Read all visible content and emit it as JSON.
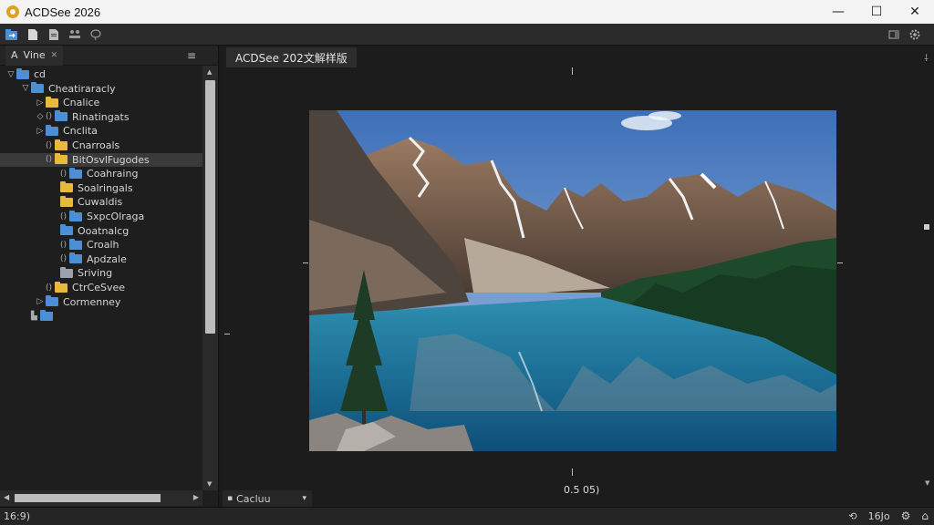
{
  "window": {
    "title": "ACDSee 2026",
    "minimize": "—",
    "maximize": "☐",
    "close": "✕"
  },
  "toolbar": {
    "icons": [
      "import-icon",
      "folder-icon",
      "file-icon",
      "people-icon",
      "tag-icon"
    ],
    "right_icons": [
      "panel-icon",
      "settings-icon"
    ]
  },
  "left_panel": {
    "tab_prefix": "A",
    "tab_label": "Vine",
    "tab_close": "✕",
    "menu_glyph": "≡",
    "tree": [
      {
        "arrow": "▽",
        "color": "blue",
        "label": "cd",
        "indent": 0
      },
      {
        "arrow": "▽",
        "color": "blue",
        "label": "Cheatiraracly",
        "indent": 1
      },
      {
        "arrow": "▷",
        "color": "yellow",
        "label": "Cnalice",
        "indent": 2
      },
      {
        "arrow": "◇",
        "color": "blue",
        "label": "Rinatingats",
        "indent": 2,
        "pre": "()"
      },
      {
        "arrow": "▷",
        "color": "blue",
        "label": "Cnclita",
        "indent": 2
      },
      {
        "arrow": "",
        "color": "yellow",
        "label": "Cnarroals",
        "indent": 2,
        "pre": "()"
      },
      {
        "arrow": "",
        "color": "yellow",
        "label": "BitOsvlFugodes",
        "indent": 2,
        "pre": "()",
        "selected": true
      },
      {
        "arrow": "",
        "color": "blue",
        "label": "Coahraing",
        "indent": 3,
        "pre": "()"
      },
      {
        "arrow": "",
        "color": "yellow",
        "label": "Soalringals",
        "indent": 3
      },
      {
        "arrow": "",
        "color": "yellow",
        "label": "Cuwaldis",
        "indent": 3
      },
      {
        "arrow": "",
        "color": "blue",
        "label": "SxpcOlraga",
        "indent": 3,
        "pre": "()"
      },
      {
        "arrow": "",
        "color": "blue",
        "label": "Ooatnalcg",
        "indent": 3
      },
      {
        "arrow": "",
        "color": "blue",
        "label": "Croalh",
        "indent": 3,
        "pre": "()"
      },
      {
        "arrow": "",
        "color": "blue",
        "label": "Apdzale",
        "indent": 3,
        "pre": "()"
      },
      {
        "arrow": "",
        "color": "grey",
        "label": "Sriving",
        "indent": 3
      },
      {
        "arrow": "",
        "color": "yellow",
        "label": "CtrCeSvee",
        "indent": 2,
        "pre": "()"
      },
      {
        "arrow": "▷",
        "color": "blue",
        "label": "Cormenney",
        "indent": 2
      },
      {
        "arrow": "",
        "color": "blue",
        "label": "",
        "indent": 1,
        "pre": "▙"
      }
    ]
  },
  "viewer": {
    "tab_label": "ACDSee 202文解样版",
    "pin_glyph": "⸸",
    "zoom_readout": "0.5 05)",
    "view_select": "Cacluu",
    "view_select_arrow": "▾",
    "photo_alt": "mountain-lake-photo"
  },
  "statusbar": {
    "left_text": "16:9)",
    "right_text": "16Jo",
    "icons": [
      "rotate-icon",
      "gear-icon",
      "home-icon"
    ]
  }
}
